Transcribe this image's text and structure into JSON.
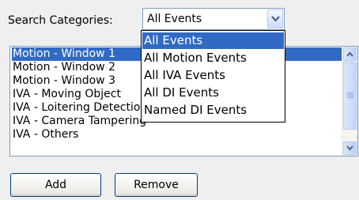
{
  "search": {
    "label": "Search Categories:",
    "selected_value": "All Events",
    "options": [
      "All Events",
      "All Motion Events",
      "All IVA Events",
      "All DI Events",
      "Named DI Events"
    ],
    "highlighted_option": "All Events"
  },
  "list": {
    "items": [
      "Motion - Window 1",
      "Motion - Window 2",
      "Motion - Window 3",
      "IVA - Moving Object",
      "IVA - Loitering Detection",
      "IVA - Camera Tampering",
      "IVA - Others"
    ],
    "selected_item": "Motion - Window 1"
  },
  "buttons": {
    "add_label": "Add",
    "remove_label": "Remove"
  },
  "colors": {
    "selection": "#316ac5",
    "border": "#7f9db9",
    "background": "#ededed"
  },
  "icons": {
    "dropdown_arrow": "chevron-down-icon",
    "scroll_up": "scroll-up-arrow-icon",
    "scroll_down": "scroll-down-arrow-icon"
  }
}
